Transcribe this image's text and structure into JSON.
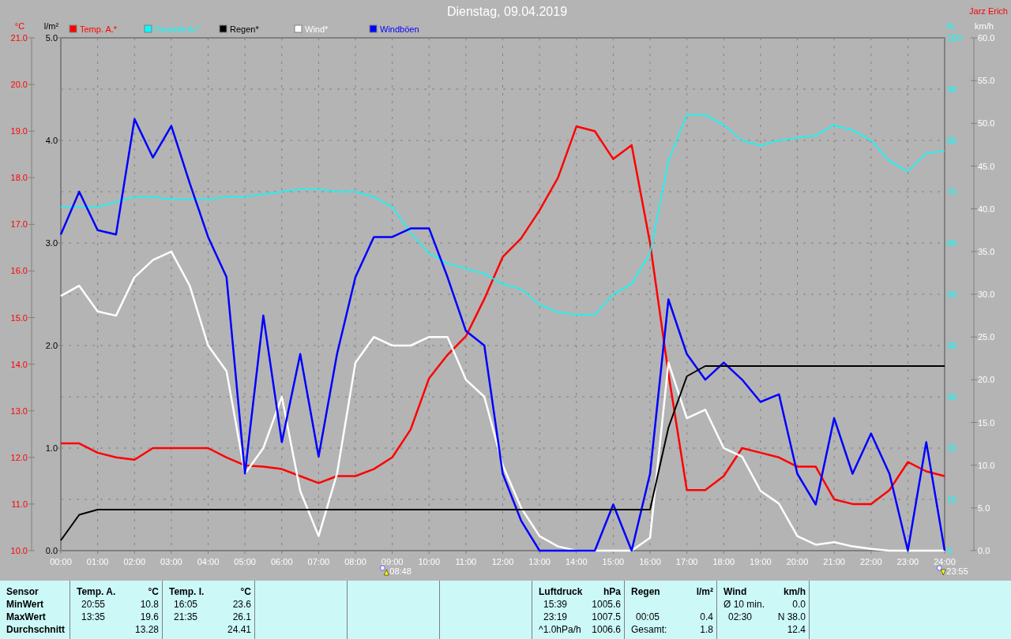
{
  "title": "Dienstag, 09.04.2019",
  "author": "Jarz Erich",
  "chart_data": {
    "type": "line",
    "x": [
      0,
      0.5,
      1,
      1.5,
      2,
      2.5,
      3,
      3.5,
      4,
      4.5,
      5,
      5.5,
      6,
      6.5,
      7,
      7.5,
      8,
      8.5,
      9,
      9.5,
      10,
      10.5,
      11,
      11.5,
      12,
      12.5,
      13,
      13.5,
      14,
      14.5,
      15,
      15.5,
      16,
      16.5,
      17,
      17.5,
      18,
      18.5,
      19,
      19.5,
      20,
      20.5,
      21,
      21.5,
      22,
      22.5,
      23,
      23.5,
      24
    ],
    "xticks": [
      {
        "value": 0,
        "label": "00:00"
      },
      {
        "value": 1,
        "label": "01:00"
      },
      {
        "value": 2,
        "label": "02:00"
      },
      {
        "value": 3,
        "label": "03:00"
      },
      {
        "value": 4,
        "label": "04:00"
      },
      {
        "value": 5,
        "label": "05:00"
      },
      {
        "value": 6,
        "label": "06:00"
      },
      {
        "value": 7,
        "label": "07:00"
      },
      {
        "value": 8,
        "label": "08:00"
      },
      {
        "value": 9,
        "label": "09:00"
      },
      {
        "value": 10,
        "label": "10:00"
      },
      {
        "value": 11,
        "label": "11:00"
      },
      {
        "value": 12,
        "label": "12:00"
      },
      {
        "value": 13,
        "label": "13:00"
      },
      {
        "value": 14,
        "label": "14:00"
      },
      {
        "value": 15,
        "label": "15:00"
      },
      {
        "value": 16,
        "label": "16:00"
      },
      {
        "value": 17,
        "label": "17:00"
      },
      {
        "value": 18,
        "label": "18:00"
      },
      {
        "value": 19,
        "label": "19:00"
      },
      {
        "value": 20,
        "label": "20:00"
      },
      {
        "value": 21,
        "label": "21:00"
      },
      {
        "value": 22,
        "label": "22:00"
      },
      {
        "value": 23,
        "label": "23:00"
      },
      {
        "value": 24,
        "label": "24:00"
      }
    ],
    "xlim": [
      0,
      24
    ],
    "ylabel": "°C",
    "ylim": [
      10,
      21
    ],
    "yticks": [
      {
        "value": 10,
        "label": "10.0"
      },
      {
        "value": 11,
        "label": "11.0"
      },
      {
        "value": 12,
        "label": "12.0"
      },
      {
        "value": 13,
        "label": "13.0"
      },
      {
        "value": 14,
        "label": "14.0"
      },
      {
        "value": 15,
        "label": "15.0"
      },
      {
        "value": 16,
        "label": "16.0"
      },
      {
        "value": 17,
        "label": "17.0"
      },
      {
        "value": 18,
        "label": "18.0"
      },
      {
        "value": 19,
        "label": "19.0"
      },
      {
        "value": 20,
        "label": "20.0"
      },
      {
        "value": 21,
        "label": "21.0"
      }
    ],
    "y2label": "%",
    "y2lim": [
      0,
      100
    ],
    "y2ticks": [
      {
        "value": 0,
        "label": "0"
      },
      {
        "value": 10,
        "label": "10"
      },
      {
        "value": 20,
        "label": "20"
      },
      {
        "value": 30,
        "label": "30"
      },
      {
        "value": 40,
        "label": "40"
      },
      {
        "value": 50,
        "label": "50"
      },
      {
        "value": 60,
        "label": "60"
      },
      {
        "value": 70,
        "label": "70"
      },
      {
        "value": 80,
        "label": "80"
      },
      {
        "value": 90,
        "label": "90"
      },
      {
        "value": 100,
        "label": "100"
      }
    ],
    "y3label": "km/h",
    "y3lim": [
      0,
      60
    ],
    "y3ticks": [
      {
        "value": 0,
        "label": "0.0"
      },
      {
        "value": 5,
        "label": "5.0"
      },
      {
        "value": 10,
        "label": "10.0"
      },
      {
        "value": 15,
        "label": "15.0"
      },
      {
        "value": 20,
        "label": "20.0"
      },
      {
        "value": 25,
        "label": "25.0"
      },
      {
        "value": 30,
        "label": "30.0"
      },
      {
        "value": 35,
        "label": "35.0"
      },
      {
        "value": 40,
        "label": "40.0"
      },
      {
        "value": 45,
        "label": "45.0"
      },
      {
        "value": 50,
        "label": "50.0"
      },
      {
        "value": 55,
        "label": "55.0"
      },
      {
        "value": 60,
        "label": "60.0"
      }
    ],
    "series": [
      {
        "name": "Temp. A.*",
        "color": "#ff0000",
        "values": [
          12.3,
          12.3,
          12.1,
          12.0,
          11.95,
          12.2,
          12.2,
          12.2,
          12.2,
          12.0,
          11.83,
          11.8,
          11.75,
          11.6,
          11.45,
          11.6,
          11.6,
          11.75,
          12.0,
          12.6,
          13.7,
          14.2,
          14.6,
          15.4,
          16.3,
          16.7,
          17.3,
          18.0,
          19.1,
          19.0,
          18.4,
          18.7,
          16.6,
          13.8,
          11.3,
          11.3,
          11.6,
          12.2,
          12.1,
          12.0,
          11.8,
          11.8,
          11.1,
          11.0,
          11.0,
          11.3,
          11.9,
          11.7,
          11.6
        ]
      },
      {
        "name": "Feuchte A.*",
        "color": "#00ffff",
        "axis": "y2",
        "values": [
          67,
          67,
          67,
          68,
          69,
          69,
          68.5,
          68.5,
          68.5,
          69,
          69,
          69.5,
          70,
          70.5,
          70.5,
          70,
          70,
          69,
          67,
          62,
          58,
          56,
          55,
          54,
          52,
          51,
          48,
          46.5,
          46,
          46,
          50,
          52,
          58,
          76,
          85,
          85,
          83,
          80,
          79,
          80,
          80.5,
          81,
          83,
          82,
          80,
          76,
          74,
          77.5,
          78
        ]
      },
      {
        "name": "Wind*",
        "color": "#ffffff",
        "axis": "y3",
        "values": [
          29.8,
          31,
          28,
          27.5,
          32,
          34,
          35,
          31,
          24,
          21,
          9,
          12,
          18,
          7,
          1.7,
          9,
          22,
          25,
          24,
          24,
          25,
          25,
          20,
          18,
          10,
          5,
          1.7,
          0.5,
          0,
          0,
          0,
          0,
          1.5,
          22,
          15.5,
          16.5,
          12,
          11,
          7,
          5.5,
          1.7,
          0.7,
          1,
          0.5,
          0.2,
          0,
          0,
          0,
          0
        ]
      },
      {
        "name": "Windböen",
        "color": "#0000ff",
        "axis": "y3",
        "values": [
          37,
          42,
          37.5,
          37,
          50.5,
          46,
          49.7,
          43,
          36.7,
          32,
          9,
          27.5,
          12.7,
          23,
          11,
          23,
          32,
          36.7,
          36.7,
          37.7,
          37.7,
          32,
          25.7,
          24,
          9,
          3.5,
          0,
          0,
          0,
          0,
          5.4,
          0,
          9,
          29.4,
          23,
          20,
          22,
          20,
          17.4,
          18.3,
          9,
          5.4,
          15.5,
          9,
          13.7,
          9,
          0,
          12.7,
          0
        ]
      }
    ],
    "grid": true,
    "legend": "top",
    "annotations": [
      "08:48",
      "23:55"
    ]
  },
  "rain_chart": {
    "chart_data": {
      "type": "line",
      "x": [
        0,
        0.5,
        1,
        1.5,
        2,
        2.5,
        3,
        3.5,
        4,
        4.5,
        5,
        5.5,
        6,
        6.5,
        7,
        7.5,
        8,
        8.5,
        9,
        9.5,
        10,
        10.5,
        11,
        11.5,
        12,
        12.5,
        13,
        13.5,
        14,
        14.5,
        15,
        15.5,
        16,
        16.5,
        17,
        17.5,
        18,
        18.5,
        19,
        19.5,
        20,
        20.5,
        21,
        21.5,
        22,
        22.5,
        23,
        23.5,
        24
      ],
      "xlim": [
        0,
        24
      ],
      "legend": "top",
      "ylabel": "l/m²",
      "ylim": [
        0,
        5
      ],
      "yticks": [
        {
          "value": 0,
          "label": "0.0"
        },
        {
          "value": 1,
          "label": "1.0"
        },
        {
          "value": 2,
          "label": "2.0"
        },
        {
          "value": 3,
          "label": "3.0"
        },
        {
          "value": 4,
          "label": "4.0"
        },
        {
          "value": 5,
          "label": "5.0"
        }
      ],
      "series": [
        {
          "name": "Regen*",
          "color": "#000000",
          "values": [
            0.1,
            0.35,
            0.4,
            0.4,
            0.4,
            0.4,
            0.4,
            0.4,
            0.4,
            0.4,
            0.4,
            0.4,
            0.4,
            0.4,
            0.4,
            0.4,
            0.4,
            0.4,
            0.4,
            0.4,
            0.4,
            0.4,
            0.4,
            0.4,
            0.4,
            0.4,
            0.4,
            0.4,
            0.4,
            0.4,
            0.4,
            0.4,
            0.4,
            1.2,
            1.7,
            1.8,
            1.8,
            1.8,
            1.8,
            1.8,
            1.8,
            1.8,
            1.8,
            1.8,
            1.8,
            1.8,
            1.8,
            1.8,
            1.8
          ]
        }
      ]
    }
  },
  "sensor_panel": {
    "columns": [
      {
        "kind": "labels",
        "header": "Sensor",
        "rows": [
          {
            "value": "MinWert"
          },
          {
            "value": "MaxWert"
          },
          {
            "value": "Durchschnitt"
          }
        ]
      },
      {
        "kind": "data",
        "header": "Temp. A.",
        "unit": "°C",
        "rows": [
          {
            "time": "20:55",
            "value": "10.8"
          },
          {
            "time": "13:35",
            "value": "19.6"
          },
          {
            "value": "13.28"
          }
        ]
      },
      {
        "kind": "data",
        "header": "Temp. I.",
        "unit": "°C",
        "rows": [
          {
            "time": "16:05",
            "value": "23.6"
          },
          {
            "time": "21:35",
            "value": "26.1"
          },
          {
            "value": "24.41"
          }
        ]
      },
      {
        "kind": "empty"
      },
      {
        "kind": "empty"
      },
      {
        "kind": "empty"
      },
      {
        "kind": "data",
        "header": "Luftdruck",
        "unit": "hPa",
        "rows": [
          {
            "time": "15:39",
            "value": "1005.6"
          },
          {
            "time": "23:19",
            "value": "1007.5"
          },
          {
            "time": "^1.0hPa/h",
            "value": "1006.6"
          }
        ]
      },
      {
        "kind": "data",
        "header": "Regen",
        "unit": "l/m²",
        "rows": [
          {},
          {
            "time": "00:05",
            "value": "0.4"
          },
          {
            "time": "Gesamt:",
            "value": "1.8"
          }
        ]
      },
      {
        "kind": "data",
        "header": "Wind",
        "unit": "km/h",
        "rows": [
          {
            "time": "Ø 10 min.",
            "value": "0.0"
          },
          {
            "time": "02:30",
            "value": "N 38.0"
          },
          {
            "value": "12.4"
          }
        ]
      }
    ]
  }
}
